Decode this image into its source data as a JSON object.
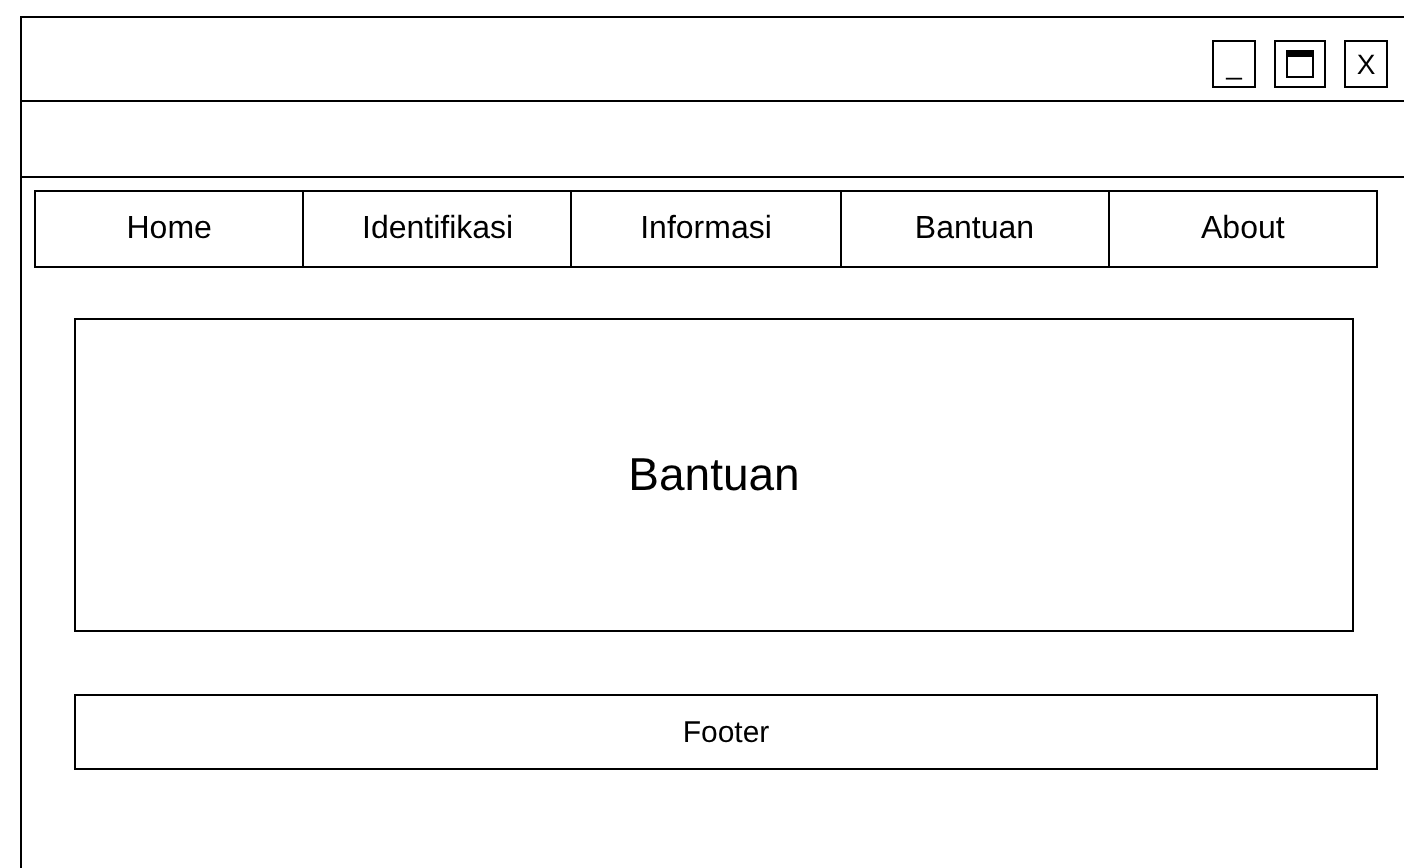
{
  "window": {
    "controls": [
      {
        "kind": "text",
        "label": "_"
      },
      {
        "kind": "maximize"
      },
      {
        "kind": "text",
        "label": "X"
      }
    ]
  },
  "nav": {
    "items": [
      {
        "label": "Home"
      },
      {
        "label": "Identifikasi"
      },
      {
        "label": "Informasi"
      },
      {
        "label": "Bantuan"
      },
      {
        "label": "About"
      }
    ]
  },
  "content": {
    "title": "Bantuan"
  },
  "footer": {
    "text": "Footer"
  }
}
